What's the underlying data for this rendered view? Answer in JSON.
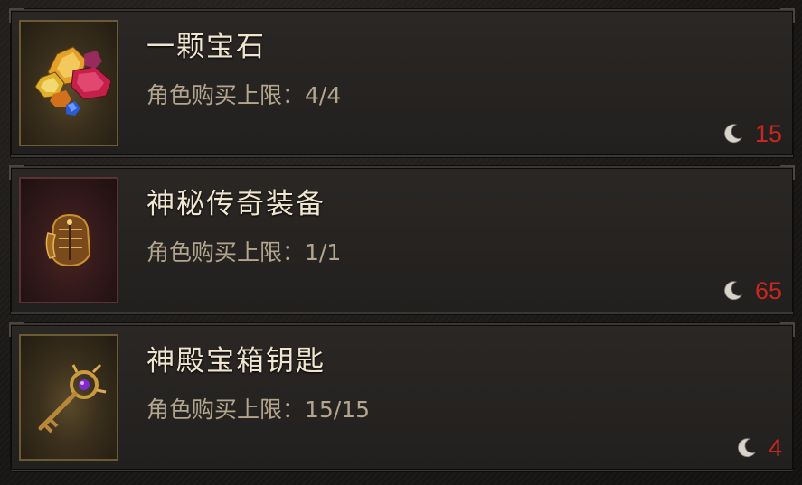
{
  "shop": {
    "items": [
      {
        "title": "一颗宝石",
        "limit_label": "角色购买上限：",
        "limit_value": "4/4",
        "price": "15",
        "icon": "gems-icon",
        "currency_icon": "crescent-moon-icon"
      },
      {
        "title": "神秘传奇装备",
        "limit_label": "角色购买上限：",
        "limit_value": "1/1",
        "price": "65",
        "icon": "gauntlet-icon",
        "currency_icon": "crescent-moon-icon"
      },
      {
        "title": "神殿宝箱钥匙",
        "limit_label": "角色购买上限：",
        "limit_value": "15/15",
        "price": "4",
        "icon": "key-icon",
        "currency_icon": "crescent-moon-icon"
      }
    ]
  },
  "colors": {
    "title": "#f0e6d0",
    "limit": "#b3a58e",
    "price": "#c8261f",
    "panel": "#22201e"
  }
}
